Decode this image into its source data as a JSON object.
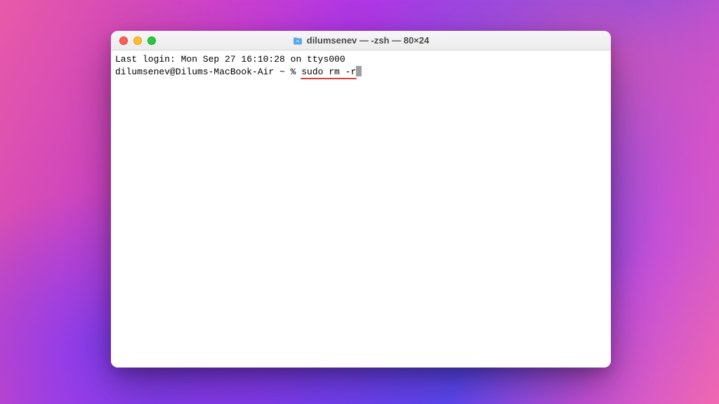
{
  "window": {
    "title": "dilumsenev — -zsh — 80×24",
    "icon_name": "home-folder-icon"
  },
  "terminal": {
    "last_login_line": "Last login: Mon Sep 27 16:10:28 on ttys000",
    "prompt": "dilumsenev@Dilums-MacBook-Air ~ % ",
    "command": "sudo rm -r"
  },
  "colors": {
    "close": "#ff5f57",
    "minimize": "#febc2e",
    "maximize": "#28c840",
    "annotation": "#e23a3a"
  }
}
